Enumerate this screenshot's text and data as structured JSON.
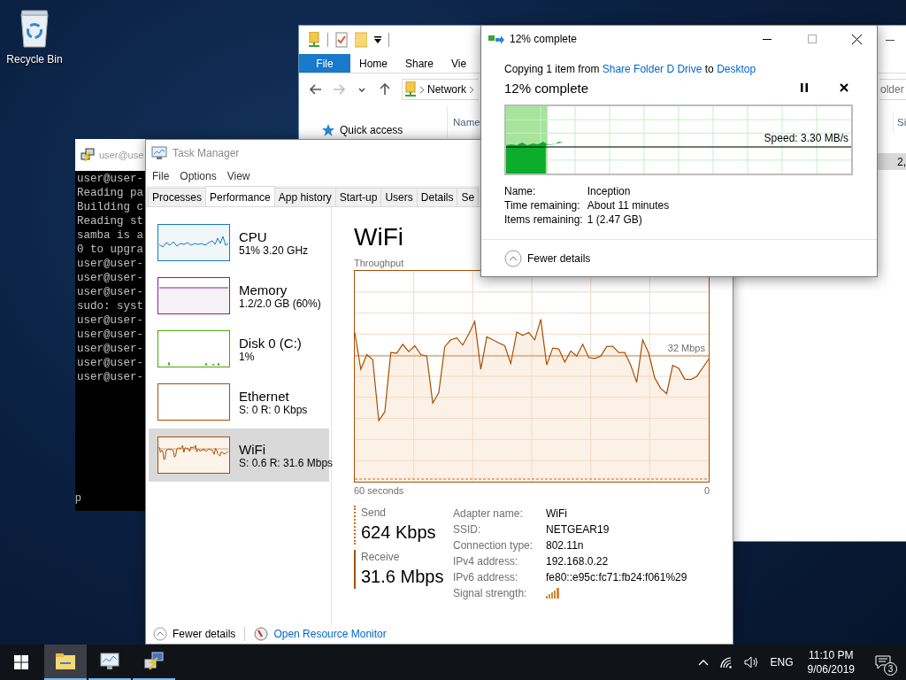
{
  "desktop_icons": [
    {
      "label": "Recycle Bin"
    }
  ],
  "explorer": {
    "ribbon_tabs": [
      {
        "label": "File",
        "kind": "menu"
      },
      {
        "label": "Home",
        "kind": "tab"
      },
      {
        "label": "Share",
        "kind": "tab"
      },
      {
        "label": "Vie",
        "kind": "tab"
      }
    ],
    "address": "Network",
    "search": {
      "placeholder": "older"
    },
    "nav_pane": [
      {
        "label": "Quick access"
      }
    ],
    "columns": [
      "Name",
      "Si"
    ],
    "rows": [
      {
        "size": "2,",
        "selected": true
      }
    ]
  },
  "terminal": {
    "title": "user@use",
    "lines": [
      "user@user-",
      "Reading pa",
      "Building c",
      "Reading st",
      "samba is a",
      "0 to upgra",
      "user@user-",
      "user@user-",
      "user@user-",
      "sudo: syst",
      "user@user-",
      "user@user-",
      "user@user-",
      "user@user-",
      "user@user-"
    ],
    "status": "p"
  },
  "task_manager": {
    "title": "Task Manager",
    "menu": [
      "File",
      "Options",
      "View"
    ],
    "tabs": [
      {
        "label": "Processes",
        "selected": false
      },
      {
        "label": "Performance",
        "selected": true
      },
      {
        "label": "App history",
        "selected": false
      },
      {
        "label": "Start-up",
        "selected": false
      },
      {
        "label": "Users",
        "selected": false
      },
      {
        "label": "Details",
        "selected": false
      },
      {
        "label": "Se",
        "selected": false
      }
    ],
    "resources": [
      {
        "name": "CPU",
        "detail": "51% 3.20 GHz",
        "kind": "cpu",
        "color": "#117dbb",
        "selected": false
      },
      {
        "name": "Memory",
        "detail": "1.2/2.0 GB (60%)",
        "kind": "memory",
        "color": "#8b12ae",
        "selected": false
      },
      {
        "name": "Disk 0 (C:)",
        "detail": "1%",
        "kind": "disk",
        "color": "#4da60c",
        "selected": false
      },
      {
        "name": "Ethernet",
        "detail": "S: 0 R: 0 Kbps",
        "kind": "idle",
        "color": "#a74f01",
        "selected": false
      },
      {
        "name": "WiFi",
        "detail": "S: 0.6 R: 31.6 Mbps",
        "kind": "wifi",
        "color": "#a74f01",
        "selected": true
      }
    ],
    "detail": {
      "title": "WiFi",
      "graph_label": "Throughput",
      "scale_label": "32 Mbps",
      "time_label": "60 seconds",
      "zero_label": "0",
      "send": {
        "label": "Send",
        "value": "624 Kbps"
      },
      "receive": {
        "label": "Receive",
        "value": "31.6 Mbps"
      },
      "properties": [
        {
          "label": "Adapter name:",
          "value": "WiFi",
          "kind": "text"
        },
        {
          "label": "SSID:",
          "value": "NETGEAR19",
          "kind": "text"
        },
        {
          "label": "Connection type:",
          "value": "802.11n",
          "kind": "text"
        },
        {
          "label": "IPv4 address:",
          "value": "192.168.0.22",
          "kind": "text"
        },
        {
          "label": "IPv6 address:",
          "value": "fe80::e95c:fc71:fb24:f061%29",
          "kind": "text"
        },
        {
          "label": "Signal strength:",
          "kind": "signal"
        }
      ]
    },
    "footer": {
      "toggle": "Fewer details",
      "link": "Open Resource Monitor"
    }
  },
  "copy_dialog": {
    "title": "12% complete",
    "message": {
      "prefix": "Copying 1 item from ",
      "source": "Share Folder D Drive",
      "middle": " to ",
      "destination": "Desktop"
    },
    "heading": "12% complete",
    "progress": {
      "level": 0.12,
      "speed": "Speed: 3.30 MB/s"
    },
    "details": [
      {
        "label": "Name:",
        "value": "Inception"
      },
      {
        "label": "Time remaining:",
        "value": "About 11 minutes"
      },
      {
        "label": "Items remaining:",
        "value": "1 (2.47 GB)"
      }
    ],
    "toggle": "Fewer details"
  },
  "taskbar": {
    "apps": [
      {
        "kind": "explorer",
        "active": true
      },
      {
        "kind": "task-manager",
        "active": false
      },
      {
        "kind": "terminal",
        "active": false
      }
    ],
    "language": "ENG",
    "time": "11:10 PM",
    "date": "9/06/2019",
    "notifications": "3"
  }
}
